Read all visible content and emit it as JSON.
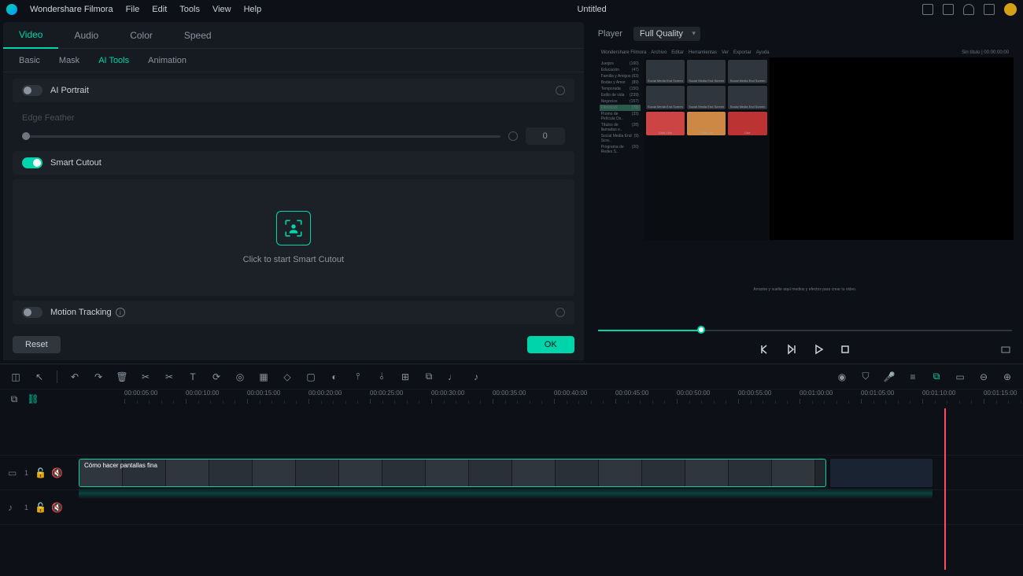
{
  "app": {
    "name": "Wondershare Filmora",
    "title": "Untitled"
  },
  "menu": [
    "File",
    "Edit",
    "Tools",
    "View",
    "Help"
  ],
  "left_panel": {
    "tabs_primary": [
      "Video",
      "Audio",
      "Color",
      "Speed"
    ],
    "tabs_primary_active": 0,
    "tabs_secondary": [
      "Basic",
      "Mask",
      "AI Tools",
      "Animation"
    ],
    "tabs_secondary_active": 2,
    "ai_portrait": {
      "label": "AI Portrait",
      "on": false
    },
    "edge_feather": {
      "label": "Edge Feather",
      "value": "0"
    },
    "smart_cutout": {
      "label": "Smart Cutout",
      "on": true,
      "cta": "Click to start Smart Cutout"
    },
    "motion_tracking": {
      "label": "Motion Tracking",
      "on": false
    },
    "reset": "Reset",
    "ok": "OK"
  },
  "player": {
    "label": "Player",
    "quality": "Full Quality"
  },
  "preview": {
    "top_menu": [
      "Archivo",
      "Editar",
      "Herramientas",
      "Ver",
      "Exportar",
      "Ayuda"
    ],
    "title": "Sin título | 00:00:00:00",
    "side_categories": [
      [
        "Juegos",
        "(160)"
      ],
      [
        "Educación",
        "(47)"
      ],
      [
        "Familia y Amigos",
        "(63)"
      ],
      [
        "Bodas y Amor",
        "(89)"
      ],
      [
        "Temporada",
        "(150)"
      ],
      [
        "Estilo de vida",
        "(239)"
      ],
      [
        "Negocios",
        "(157)"
      ],
      [
        "Filmstock",
        "(78)"
      ],
      [
        "Promo de Película Os..",
        "(33)"
      ],
      [
        "Títulos de llamadas e..",
        "(28)"
      ],
      [
        "Social Media End Scre..",
        "(9)"
      ],
      [
        "Programa de Redes S..",
        "(20)"
      ]
    ],
    "thumbs": [
      "Social Media End Screen",
      "Social Media End Screen",
      "Social Media End Screen",
      "Social Media End Screen",
      "Social Media End Screen",
      "Social Media End Screen",
      "Click Like",
      "Click Like",
      "Like"
    ],
    "drop_hint": "Arrastre y suelte aquí medios y efectos para crear tu video."
  },
  "timeline": {
    "marks": [
      "00:00:05:00",
      "00:00:10:00",
      "00:00:15:00",
      "00:00:20:00",
      "00:00:25:00",
      "00:00:30:00",
      "00:00:35:00",
      "00:00:40:00",
      "00:00:45:00",
      "00:00:50:00",
      "00:00:55:00",
      "00:01:00:00",
      "00:01:05:00",
      "00:01:10:00",
      "00:01:15:00"
    ],
    "clip_label": "Cómo hacer pantallas fina",
    "track_video": "1",
    "track_audio": "1"
  }
}
